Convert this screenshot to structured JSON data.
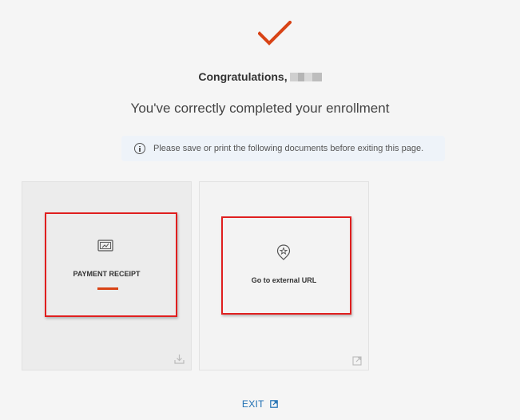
{
  "header": {
    "title_prefix": "Congratulations,",
    "subtitle": "You've correctly completed your enrollment"
  },
  "notice": {
    "text": "Please save or print the following documents before exiting this page.",
    "icon": "info-icon"
  },
  "cards": [
    {
      "label": "PAYMENT RECEIPT",
      "icon": "receipt-icon",
      "corner_icon": "download-icon"
    },
    {
      "label": "Go to external URL",
      "icon": "badge-star-icon",
      "corner_icon": "external-link-icon"
    }
  ],
  "footer": {
    "exit_label": "EXIT",
    "exit_icon": "external-link-icon"
  },
  "colors": {
    "accent": "#d84315",
    "link": "#1f6fb2",
    "highlight": "#e01f1f",
    "notice_bg": "#eef3f9"
  }
}
